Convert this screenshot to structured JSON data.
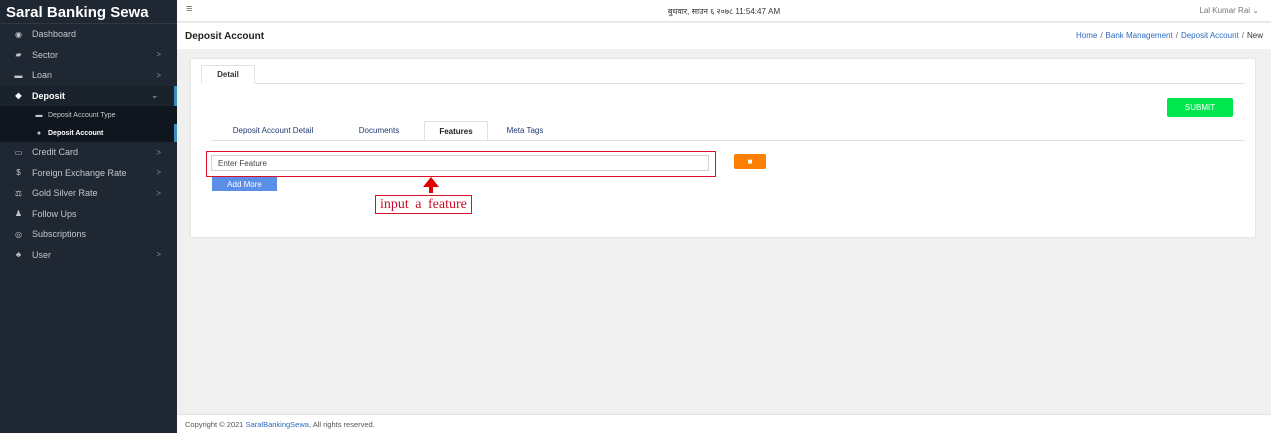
{
  "sidebar": {
    "brand": "Saral Banking Sewa",
    "items": [
      {
        "label": "Dashboard",
        "icon": "dashboard-icon",
        "glyph": "◉",
        "chevron": ""
      },
      {
        "label": "Sector",
        "icon": "folder-icon",
        "glyph": "▰",
        "chevron": ">"
      },
      {
        "label": "Loan",
        "icon": "money-icon",
        "glyph": "▬",
        "chevron": ">"
      },
      {
        "label": "Deposit",
        "icon": "piggy-bank-icon",
        "glyph": "◆",
        "chevron": "⌄"
      }
    ],
    "subitems": [
      {
        "label": "Deposit Account Type",
        "icon": "card-icon",
        "glyph": "▬"
      },
      {
        "label": "Deposit Account",
        "icon": "account-icon",
        "glyph": "●"
      }
    ],
    "items_after": [
      {
        "label": "Credit Card",
        "icon": "credit-card-icon",
        "glyph": "▭",
        "chevron": ">"
      },
      {
        "label": "Foreign Exchange Rate",
        "icon": "dollar-icon",
        "glyph": "$",
        "chevron": ">"
      },
      {
        "label": "Gold Silver Rate",
        "icon": "gold-icon",
        "glyph": "⚖",
        "chevron": ">"
      },
      {
        "label": "Follow Ups",
        "icon": "user-follow-icon",
        "glyph": "♟",
        "chevron": ""
      },
      {
        "label": "Subscriptions",
        "icon": "subscription-icon",
        "glyph": "◎",
        "chevron": ""
      },
      {
        "label": "User",
        "icon": "users-icon",
        "glyph": "♣",
        "chevron": ">"
      }
    ]
  },
  "topbar": {
    "datetime": "बुधवार, साउन ६ २०७८ 11:54:47 AM",
    "user": "Lal Kumar Rai ⌄"
  },
  "page": {
    "title": "Deposit Account",
    "breadcrumb": [
      "Home",
      "Bank Management",
      "Deposit Account",
      "New"
    ]
  },
  "card": {
    "detail_tab": "Detail",
    "submit_label": "SUBMIT",
    "tabs": [
      "Deposit Account Detail",
      "Documents",
      "Features",
      "Meta Tags"
    ],
    "active_tab": "Features",
    "feature_placeholder": "Enter Feature",
    "add_more_label": "Add More",
    "delete_glyph": "■"
  },
  "annotation": {
    "text": "input a feature",
    "color": "#d9112b"
  },
  "footer": {
    "prefix": "Copyright © 2021 ",
    "link": "SaralBankingSewa",
    "suffix": ", All rights reserved."
  },
  "colors": {
    "sidebar_bg": "#1e2732",
    "submit": "#00e64d",
    "delete": "#ff8000",
    "add_more": "#5b8ee6",
    "link": "#2a6bbf"
  }
}
